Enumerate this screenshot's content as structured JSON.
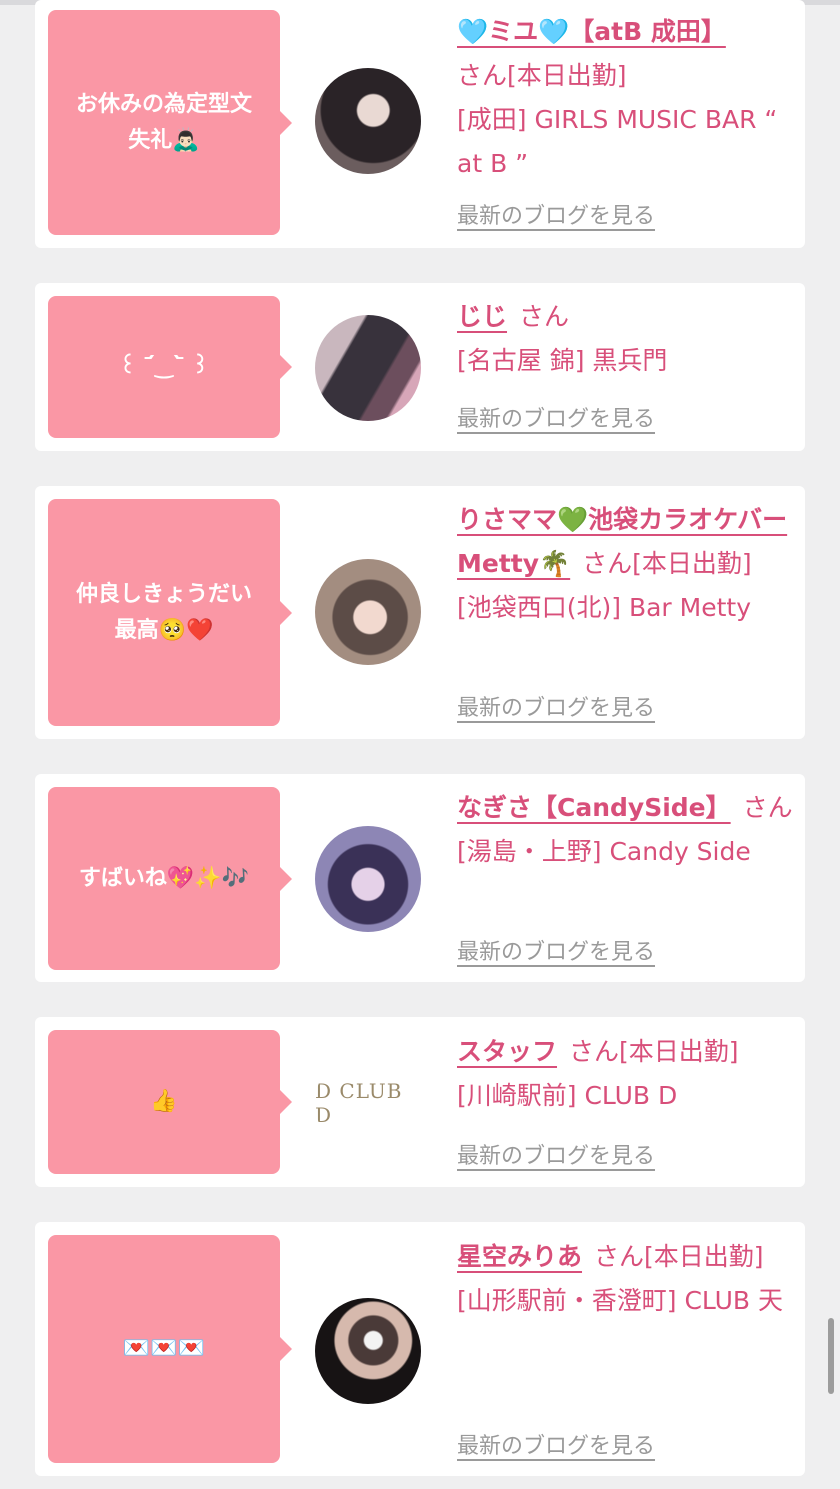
{
  "blog_link_label": "最新のブログを見る",
  "colors": {
    "accent": "#d84f7a",
    "bubble": "#fa97a5",
    "background": "#efeff0",
    "muted_link": "#9a9a9a"
  },
  "entries": [
    {
      "comment_line1": "お休みの為定型文",
      "comment_line2": "失礼🙇🏻‍♂️",
      "name": "🩵ミユ🩵【atB 成田】",
      "suffix": "さん[本日出勤]",
      "shop": "[成田] GIRLS MUSIC BAR “ at B ”"
    },
    {
      "comment_line1": "꒰ ˊ᷄‿ˋ᷅ ꒱",
      "comment_line2": "",
      "name": "じじ",
      "suffix": "さん",
      "shop": "[名古屋 錦] 黒兵門"
    },
    {
      "comment_line1": "仲良しきょうだい",
      "comment_line2": "最高🥺❤️",
      "name": "りさママ💚池袋カラオケバーMetty🌴",
      "suffix": "さん[本日出勤]",
      "shop": "[池袋西口(北)] Bar Metty"
    },
    {
      "comment_line1": "すばいね💖✨🎶",
      "comment_line2": "",
      "name": "なぎさ【CandySide】",
      "suffix": "さん",
      "shop": "[湯島・上野] Candy Side"
    },
    {
      "comment_line1": "👍",
      "comment_line2": "",
      "name": "スタッフ",
      "suffix": "さん[本日出勤]",
      "shop": "[川崎駅前] CLUB D",
      "avatar_text": "D CLUB D"
    },
    {
      "comment_line1": "💌💌💌",
      "comment_line2": "",
      "name": "星空みりあ",
      "suffix": "さん[本日出勤]",
      "shop": "[山形駅前・香澄町] CLUB 天"
    }
  ]
}
